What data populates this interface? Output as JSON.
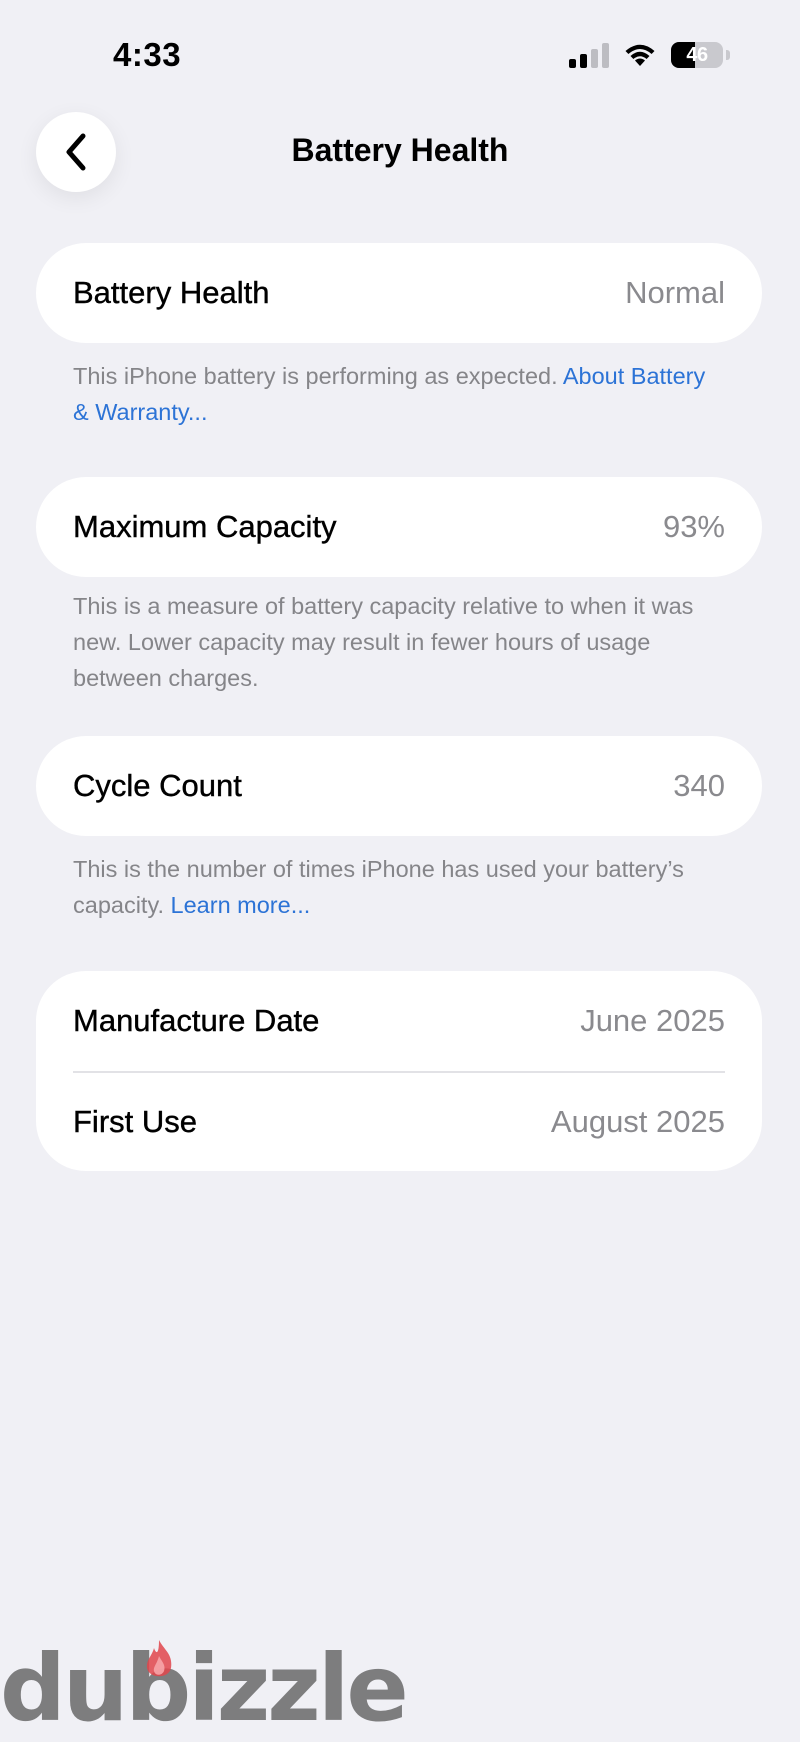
{
  "status_bar": {
    "time": "4:33",
    "battery_level": "46",
    "icons": [
      "cellular-signal-icon",
      "wifi-icon",
      "battery-icon"
    ]
  },
  "nav": {
    "title": "Battery Health",
    "back_icon": "chevron-left-icon"
  },
  "battery_health": {
    "label": "Battery Health",
    "value": "Normal",
    "footnote": "This iPhone battery is performing as expected.",
    "link": "About Battery & Warranty..."
  },
  "maximum_capacity": {
    "label": "Maximum Capacity",
    "value": "93%",
    "footnote": "This is a measure of battery capacity relative to when it was new. Lower capacity may result in fewer hours of usage between charges."
  },
  "cycle_count": {
    "label": "Cycle Count",
    "value": "340",
    "footnote": "This is the number of times iPhone has used your battery’s capacity.",
    "link": "Learn more..."
  },
  "dates": {
    "manufacture_label": "Manufacture Date",
    "manufacture_value": "June 2025",
    "first_use_label": "First Use",
    "first_use_value": "August 2025"
  },
  "watermark": {
    "text": "dubizzle"
  },
  "colors": {
    "background": "#f0f0f5",
    "card": "#ffffff",
    "link": "#2c73d6",
    "secondary_text": "#8a8a8e",
    "flame": "#e0454b"
  }
}
